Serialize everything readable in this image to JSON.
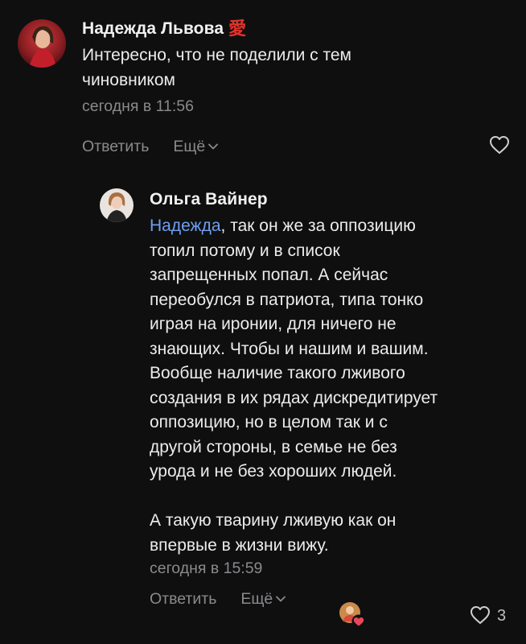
{
  "comments": [
    {
      "author": "Надежда Львова",
      "badge": "愛",
      "text": "Интересно, что не поделили с тем\nчиновником",
      "time": "сегодня в 11:56",
      "reply_label": "Ответить",
      "more_label": "Ещё"
    },
    {
      "author": "Ольга Вайнер",
      "mention": "Надежда",
      "text": ", так он же за оппозицию\nтопил потому и в список\nзапрещенных попал. А сейчас\nпереобулся в патриота, типа тонко\nиграя на иронии, для ничего не\nзнающих. Чтобы и нашим и вашим.\nВообще наличие такого лживого\nсоздания в их рядах дискредитирует\nоппозицию, но в целом так и с\nдругой стороны, в семье не без\nурода и не без хороших людей.\n\nА такую тварину лживую как он\nвпервые в жизни вижу.",
      "time": "сегодня в 15:59",
      "reply_label": "Ответить",
      "more_label": "Ещё",
      "likes": "3"
    }
  ],
  "colors": {
    "background": "#0f0f10",
    "mention": "#6f9ff0",
    "muted": "#8a8a8d",
    "badge": "#e0342b",
    "like_active": "#e8475a"
  },
  "icons": {
    "like": "heart-outline-icon",
    "more": "chevron-down-icon",
    "reactor": "reactor-avatar-heart-icon"
  }
}
